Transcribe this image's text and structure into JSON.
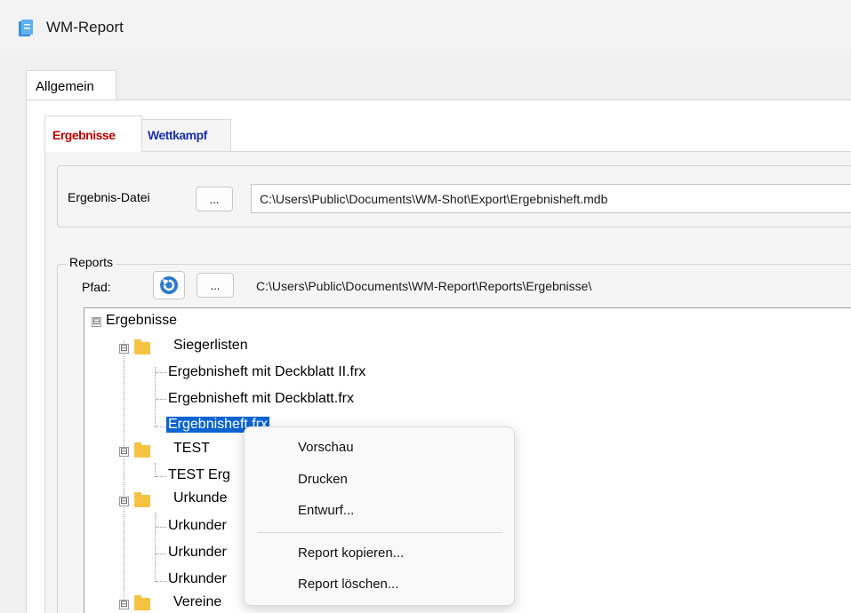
{
  "window": {
    "title": "WM-Report"
  },
  "outer_tab": {
    "label": "Allgemein"
  },
  "inner_tabs": [
    {
      "label": "Ergebnisse",
      "color": "#c00000"
    },
    {
      "label": "Wettkampf",
      "color": "#1f2fb0"
    }
  ],
  "ergebnis": {
    "label": "Ergebnis-Datei",
    "browse_label": "...",
    "path": "C:\\Users\\Public\\Documents\\WM-Shot\\Export\\Ergebnisheft.mdb"
  },
  "reports": {
    "group_label": "Reports",
    "pfad_label": "Pfad:",
    "browse_label": "...",
    "refresh_icon": "refresh-icon",
    "path": "C:\\Users\\Public\\Documents\\WM-Report\\Reports\\Ergebnisse\\"
  },
  "tree": {
    "root": "Ergebnisse",
    "siegerlisten": "Siegerlisten",
    "siegerlisten_files": [
      "Ergebnisheft mit Deckblatt II.frx",
      "Ergebnisheft mit Deckblatt.frx",
      "Ergebnisheft.frx"
    ],
    "test": "TEST",
    "test_files": [
      "TEST Erg"
    ],
    "urkunden": "Urkunde",
    "urkunden_files": [
      "Urkunder",
      "Urkunder",
      "Urkunder"
    ],
    "vereine": "Vereine",
    "expander_symbol": "⊟"
  },
  "context_menu": {
    "items": [
      "Vorschau",
      "Drucken",
      "Entwurf...",
      "Report kopieren...",
      "Report löschen..."
    ]
  },
  "colors": {
    "selection": "#0a64d2",
    "folder": "#f5c242"
  }
}
